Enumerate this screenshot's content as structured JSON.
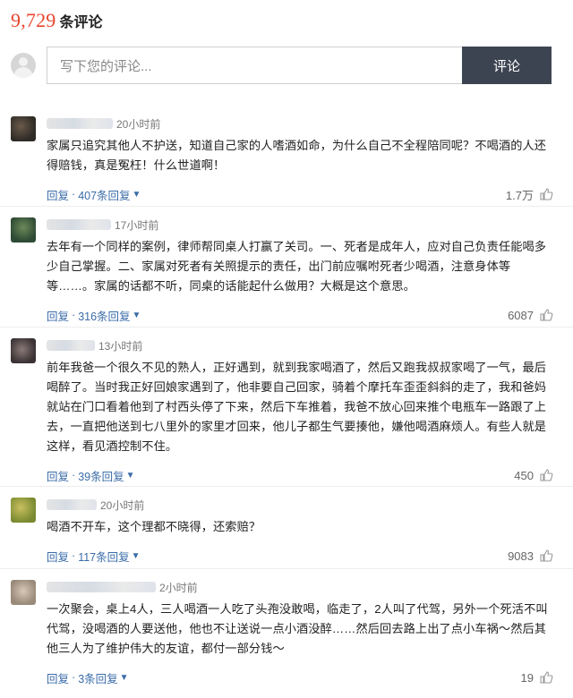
{
  "header": {
    "count": "9,729",
    "label": "条评论"
  },
  "composer": {
    "placeholder": "写下您的评论...",
    "submit_label": "评论"
  },
  "ui": {
    "reply_label": "回复",
    "separator": "·"
  },
  "comments": [
    {
      "time": "20小时前",
      "text": "家属只追究其他人不护送，知道自己家的人嗜酒如命，为什么自己不全程陪同呢？不喝酒的人还得赔钱，真是冤枉！什么世道啊！",
      "replies": "407条回复",
      "likes": "1.7万"
    },
    {
      "time": "17小时前",
      "text": "去年有一个同样的案例，律师帮同桌人打赢了关司。一、死者是成年人，应对自己负责任能喝多少自己掌握。二、家属对死者有关照提示的责任，出门前应嘱咐死者少喝酒，注意身体等等……。家属的话都不听，同桌的话能起什么做用？大概是这个意思。",
      "replies": "316条回复",
      "likes": "6087"
    },
    {
      "time": "13小时前",
      "text": "前年我爸一个很久不见的熟人，正好遇到，就到我家喝酒了，然后又跑我叔叔家喝了一气，最后喝醉了。当时我正好回娘家遇到了，他非要自己回家，骑着个摩托车歪歪斜斜的走了，我和爸妈就站在门口看着他到了村西头停了下来，然后下车推着，我爸不放心回来推个电瓶车一路跟了上去，一直把他送到七八里外的家里才回来，他儿子都生气要揍他，嫌他喝酒麻烦人。有些人就是这样，看见酒控制不住。",
      "replies": "39条回复",
      "likes": "450"
    },
    {
      "time": "20小时前",
      "text": "喝酒不开车，这个理都不晓得，还索赔？",
      "replies": "117条回复",
      "likes": "9083"
    },
    {
      "time": "2小时前",
      "text": "一次聚会，桌上4人，三人喝酒一人吃了头孢没敢喝，临走了，2人叫了代驾，另外一个死活不叫代驾，没喝酒的人要送他，他也不让送说一点小酒没醉……然后回去路上出了点小车祸～然后其他三人为了维护伟大的友谊，都付一部分钱～",
      "replies": "3条回复",
      "likes": "19"
    }
  ],
  "colors": {
    "accent_count": "#e8462e",
    "link": "#3b6ca8",
    "button_bg": "#3d4451"
  }
}
